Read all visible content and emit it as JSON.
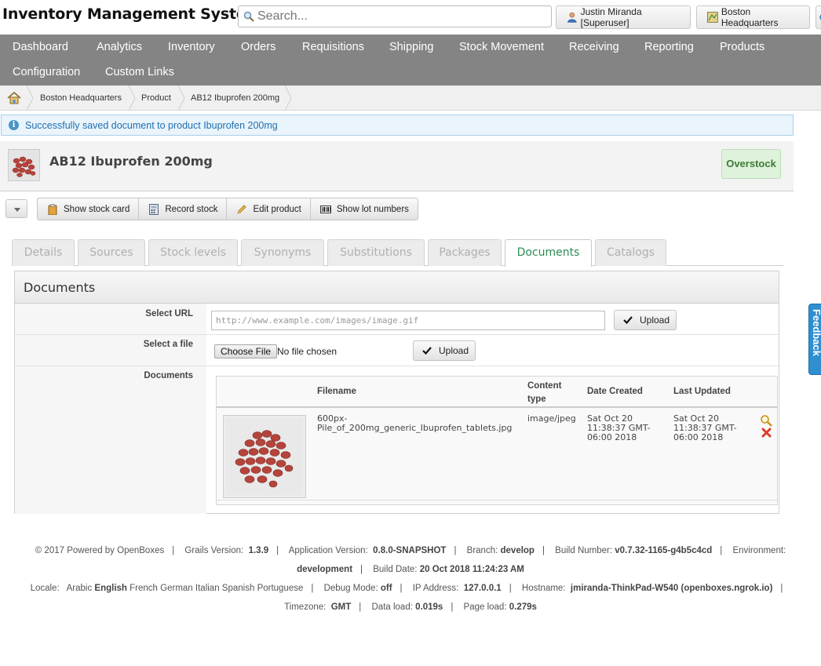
{
  "header": {
    "app_title": "Inventory Management System",
    "search_placeholder": "Search...",
    "user_label": "Justin Miranda [Superuser]",
    "location_label": "Boston Headquarters"
  },
  "nav": {
    "row1": [
      "Dashboard",
      "Analytics",
      "Inventory",
      "Orders",
      "Requisitions",
      "Shipping",
      "Stock Movement",
      "Receiving",
      "Reporting",
      "Products"
    ],
    "row2": [
      "Configuration",
      "Custom Links"
    ]
  },
  "breadcrumb": [
    "Boston Headquarters",
    "Product",
    "AB12 Ibuprofen 200mg"
  ],
  "message": "Successfully saved document to product Ibuprofen 200mg",
  "product": {
    "name": "AB12 Ibuprofen 200mg",
    "status": "Overstock"
  },
  "actions": [
    "Show stock card",
    "Record stock",
    "Edit product",
    "Show lot numbers"
  ],
  "tabs": [
    "Details",
    "Sources",
    "Stock levels",
    "Synonyms",
    "Substitutions",
    "Packages",
    "Documents",
    "Catalogs"
  ],
  "active_tab": "Documents",
  "panel": {
    "title": "Documents",
    "select_url_label": "Select URL",
    "url_placeholder": "http://www.example.com/images/image.gif",
    "upload_label": "Upload",
    "select_file_label": "Select a file",
    "choose_file_label": "Choose File",
    "no_file_text": "No file chosen",
    "documents_label": "Documents",
    "table": {
      "headers": [
        "Filename",
        "Content type",
        "Date Created",
        "Last Updated"
      ],
      "header_content_type_lines": [
        "Content",
        "type"
      ],
      "rows": [
        {
          "filename_lines": [
            "600px-",
            "Pile_of_200mg_generic_Ibuprofen_tablets.jpg"
          ],
          "content_type": "image/jpeg",
          "date_created_lines": [
            "Sat Oct 20",
            "11:38:37 GMT-",
            "06:00 2018"
          ],
          "last_updated_lines": [
            "Sat Oct 20",
            "11:38:37 GMT-",
            "06:00 2018"
          ]
        }
      ]
    }
  },
  "feedback_label": "Feedback",
  "footer": {
    "copyright": "© 2017 Powered by OpenBoxes",
    "grails_label": "Grails Version:",
    "grails_version": "1.3.9",
    "app_version_label": "Application Version:",
    "app_version": "0.8.0-SNAPSHOT",
    "branch_label": "Branch:",
    "branch": "develop",
    "build_number_label": "Build Number:",
    "build_number": "v0.7.32-1165-g4b5c4cd",
    "environment_label": "Environment:",
    "environment": "development",
    "build_date_label": "Build Date:",
    "build_date": "20 Oct 2018 11:24:23 AM",
    "locale_label": "Locale:",
    "locales": [
      "Arabic",
      "English",
      "French",
      "German",
      "Italian",
      "Spanish",
      "Portuguese"
    ],
    "debug_label": "Debug Mode:",
    "debug": "off",
    "ip_label": "IP Address:",
    "ip": "127.0.0.1",
    "hostname_label": "Hostname:",
    "hostname": "jmiranda-ThinkPad-W540 (openboxes.ngrok.io)",
    "timezone_label": "Timezone:",
    "timezone": "GMT",
    "data_load_label": "Data load:",
    "data_load": "0.019s",
    "page_load_label": "Page load:",
    "page_load": "0.279s"
  }
}
